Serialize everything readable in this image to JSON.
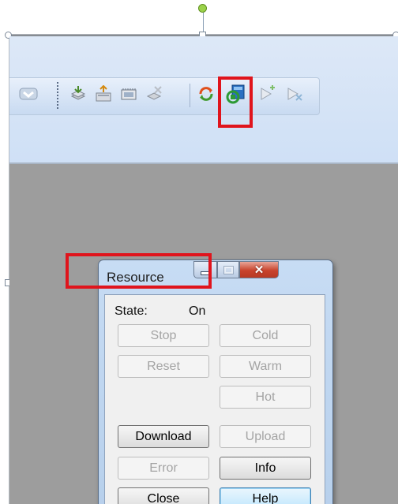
{
  "toolbar": {
    "icons": [
      "chevron-down-icon",
      "load-icon",
      "upload-icon",
      "memory-icon",
      "delete-icon",
      "refresh-icon",
      "resource-icon",
      "play-icon",
      "stop-icon"
    ]
  },
  "dialog": {
    "title": "Resource",
    "state_label": "State:",
    "state_value": "On",
    "buttons": {
      "stop": "Stop",
      "cold": "Cold",
      "reset": "Reset",
      "warm": "Warm",
      "hot": "Hot",
      "download": "Download",
      "upload": "Upload",
      "error": "Error",
      "info": "Info",
      "close": "Close",
      "help": "Help"
    }
  },
  "colors": {
    "highlight": "#e0141c",
    "toolbar": "#d4e3f6",
    "background": "#9d9d9d"
  }
}
